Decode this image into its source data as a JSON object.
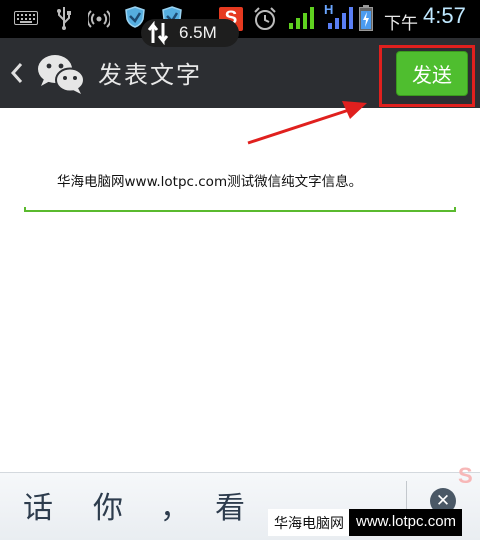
{
  "status_bar": {
    "network_speed": "6.5M",
    "period_label": "下午",
    "time": "4:57",
    "icons": [
      "keyboard-icon",
      "usb-icon",
      "wifi-hotspot-icon",
      "shield-icon",
      "shield-icon",
      "sogou-input-icon",
      "alarm-icon",
      "signal-icon",
      "signal-h-icon",
      "battery-charging-icon",
      "sync-arrows-icon"
    ],
    "sogou_glyph": "S",
    "signal_h": "H"
  },
  "title_bar": {
    "title": "发表文字",
    "send_label": "发送"
  },
  "content": {
    "message": "华海电脑网www.lotpc.com测试微信纯文字信息。"
  },
  "keyboard": {
    "candidates": [
      "话",
      "你",
      "，",
      "看"
    ],
    "delete_glyph": "✕",
    "brand_glyph": "S"
  },
  "watermark": {
    "site_name": "华海电脑网",
    "url": "www.lotpc.com"
  },
  "colors": {
    "status_bar_bg": "#000000",
    "title_bar_bg": "#2c2e32",
    "send_button": "#4fbe2f",
    "annotation_red": "#e0201e",
    "input_underline": "#5aba2e"
  }
}
